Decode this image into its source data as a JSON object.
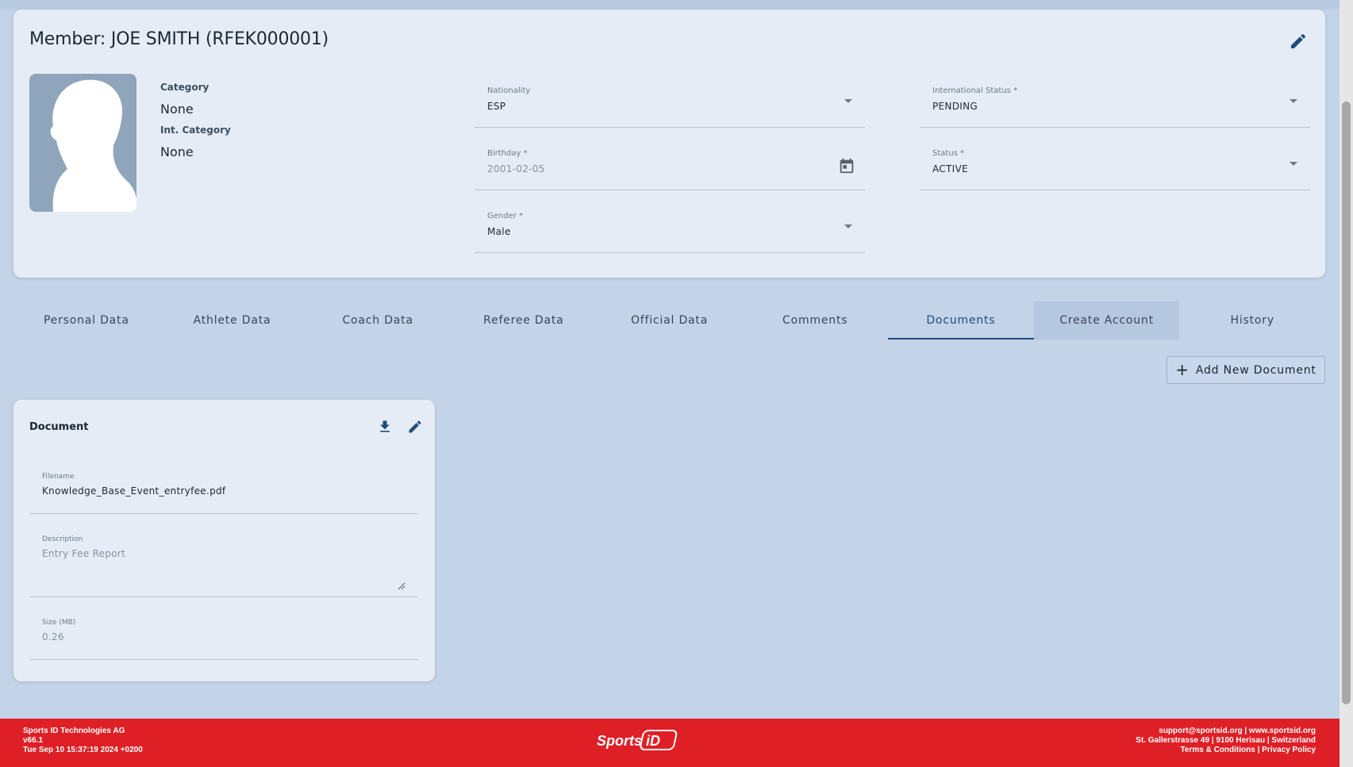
{
  "member": {
    "title": "Member: JOE SMITH (RFEK000001)",
    "category_label": "Category",
    "category_value": "None",
    "int_category_label": "Int. Category",
    "int_category_value": "None",
    "nationality": {
      "label": "Nationality",
      "value": "ESP"
    },
    "international_status": {
      "label": "International Status *",
      "value": "PENDING"
    },
    "birthday": {
      "label": "Birthday *",
      "value": "2001-02-05"
    },
    "status": {
      "label": "Status *",
      "value": "ACTIVE"
    },
    "gender": {
      "label": "Gender *",
      "value": "Male"
    }
  },
  "tabs": [
    {
      "label": "Personal Data"
    },
    {
      "label": "Athlete Data"
    },
    {
      "label": "Coach Data"
    },
    {
      "label": "Referee Data"
    },
    {
      "label": "Official Data"
    },
    {
      "label": "Comments"
    },
    {
      "label": "Documents",
      "active": true
    },
    {
      "label": "Create Account"
    },
    {
      "label": "History"
    }
  ],
  "add_document_label": "Add New Document",
  "document": {
    "title": "Document",
    "filename": {
      "label": "Filename",
      "value": "Knowledge_Base_Event_entryfee.pdf"
    },
    "description": {
      "label": "Description",
      "value": "Entry Fee Report"
    },
    "size": {
      "label": "Size (MB)",
      "value": "0.26"
    }
  },
  "footer": {
    "company": "Sports ID Technologies AG",
    "version": "v66.1",
    "build_date": "Tue Sep 10 15:37:19 2024 +0200",
    "contact": "support@sportsid.org | www.sportsid.org",
    "address": "St. Gallerstrasse 49 | 9100 Herisau | Switzerland",
    "terms": "Terms & Conditions",
    "separator": " | ",
    "privacy": "Privacy Policy",
    "logo_text": "Sports iD"
  },
  "colors": {
    "background": "#c3d3e8",
    "card": "#e6ecf5",
    "accent": "#1f4d7a",
    "footer": "#de1f26"
  },
  "icons": [
    "pencil-icon",
    "calendar-icon",
    "plus-icon",
    "download-icon",
    "caret-down-icon"
  ]
}
